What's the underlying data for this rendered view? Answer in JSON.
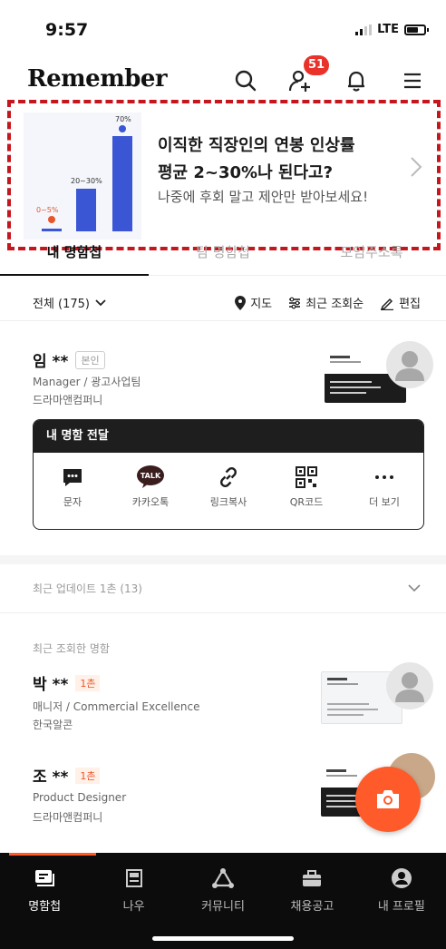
{
  "status_bar": {
    "time": "9:57",
    "network": "LTE"
  },
  "header": {
    "logo": "Remember",
    "notification_count": "51"
  },
  "banner": {
    "line1": "이직한 직장인의 연봉 인상률",
    "line2": "평균 2~30%나 된다고?",
    "line3": "나중에 후회 말고 제안만 받아보세요!",
    "bar_labels": [
      "0~5%",
      "20~30%",
      "70%"
    ]
  },
  "tabs": [
    {
      "label": "내 명함첩"
    },
    {
      "label": "팀 명함첩"
    },
    {
      "label": "모임주소록"
    }
  ],
  "filter": {
    "count": "전체 (175)",
    "map": "지도",
    "sort": "최근 조회순",
    "edit": "편집"
  },
  "my_card": {
    "name": "임 **",
    "badge": "본인",
    "title": "Manager / 광고사업팀",
    "company": "드라마앤컴퍼니"
  },
  "share": {
    "header": "내 명함 전달",
    "items": [
      {
        "label": "문자",
        "icon": "message-icon"
      },
      {
        "label": "카카오톡",
        "icon": "kakaotalk-icon"
      },
      {
        "label": "링크복사",
        "icon": "link-icon"
      },
      {
        "label": "QR코드",
        "icon": "qr-icon"
      },
      {
        "label": "더 보기",
        "icon": "more-icon"
      }
    ]
  },
  "updates": {
    "label": "최근 업데이트 1촌 (13)"
  },
  "recent": {
    "title": "최근 조회한 명함",
    "contacts": [
      {
        "name": "박 **",
        "degree": "1촌",
        "title": "매니저 / Commercial Excellence",
        "company": "한국알콘"
      },
      {
        "name": "조 **",
        "degree": "1촌",
        "title": "Product Designer",
        "company": "드라마앤컴퍼니"
      }
    ]
  },
  "bottom_nav": [
    {
      "label": "명함첩",
      "icon": "cardbook-icon"
    },
    {
      "label": "나우",
      "icon": "now-icon"
    },
    {
      "label": "커뮤니티",
      "icon": "community-icon"
    },
    {
      "label": "채용공고",
      "icon": "jobs-icon"
    },
    {
      "label": "내 프로필",
      "icon": "profile-icon"
    }
  ],
  "colors": {
    "accent": "#ff5a2a",
    "badge": "#e8322a",
    "banner_border": "#c4161c",
    "nav_bg": "#0c0c0c"
  }
}
